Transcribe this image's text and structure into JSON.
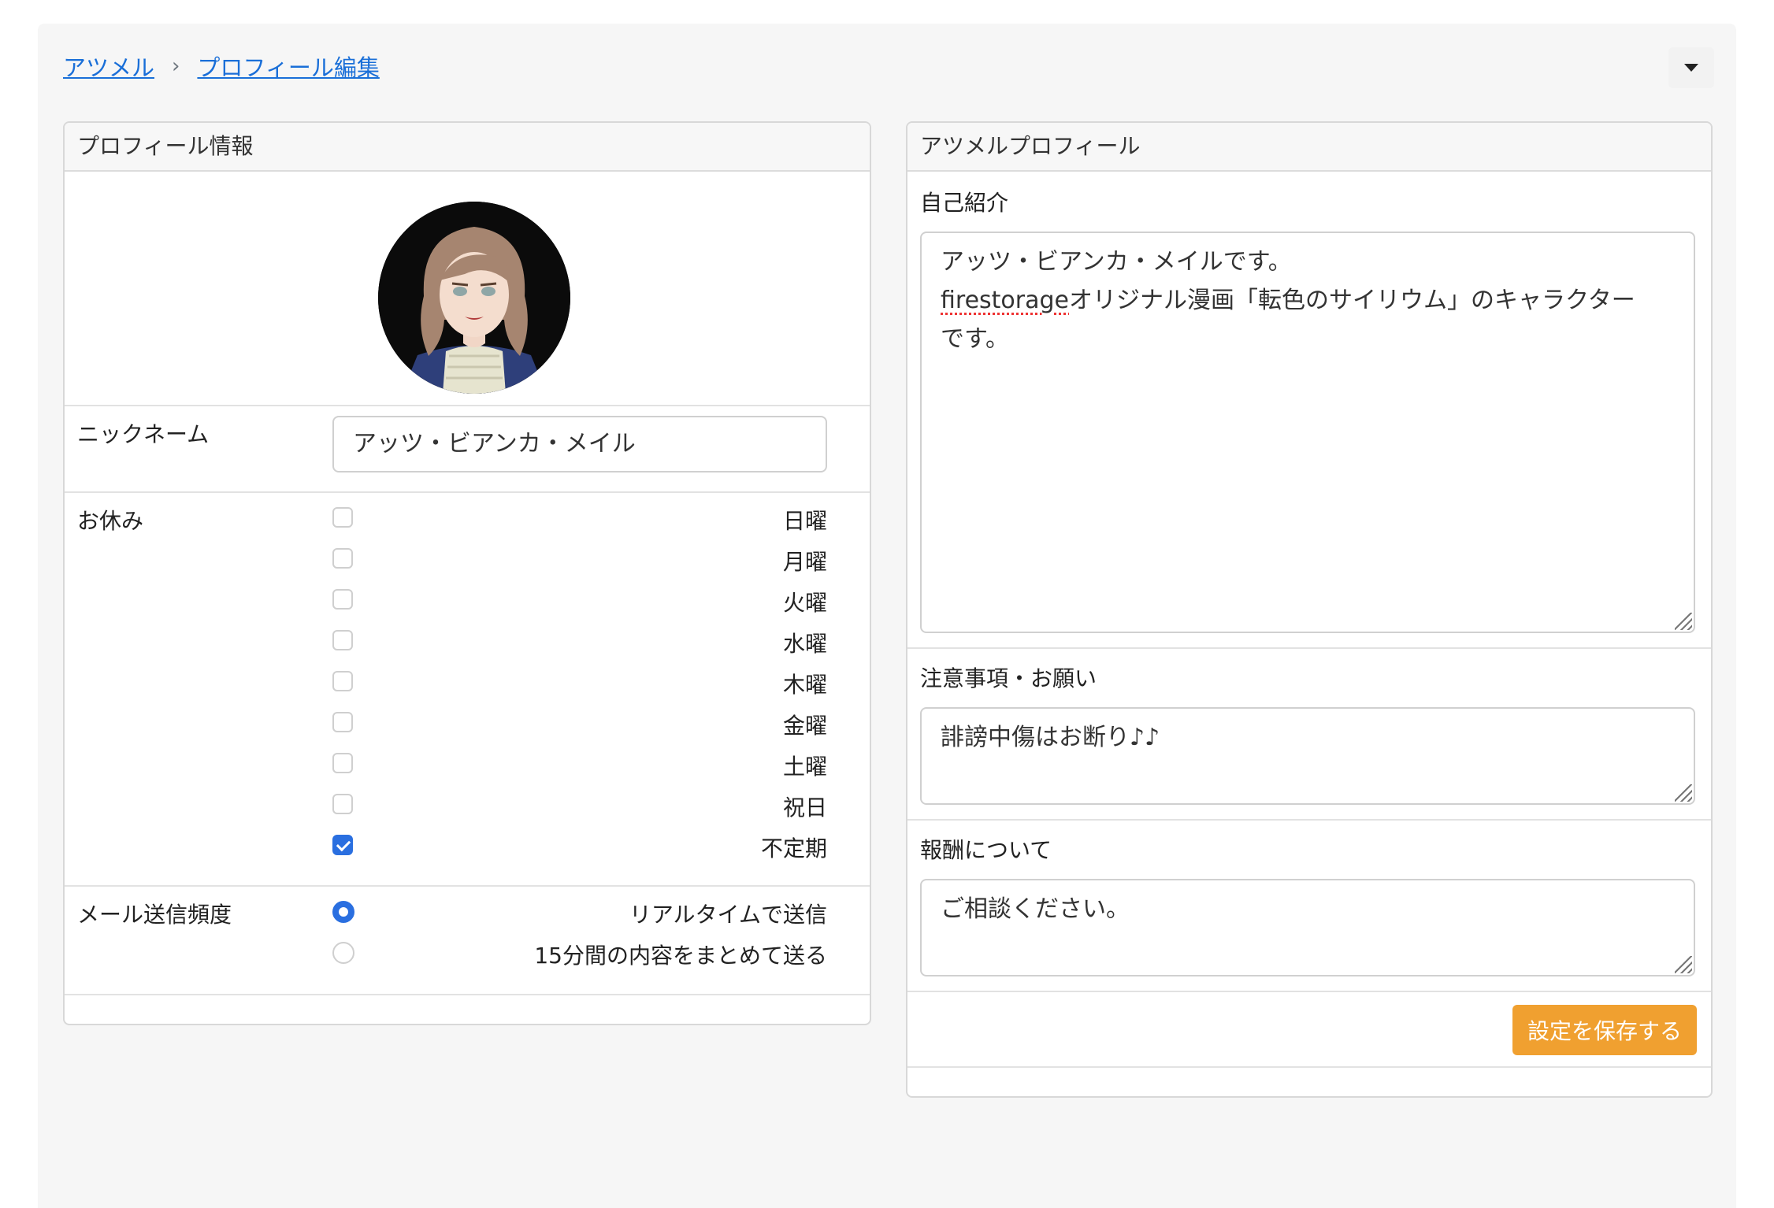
{
  "breadcrumb": {
    "home": "アツメル",
    "current": "プロフィール編集"
  },
  "profile_card": {
    "title": "プロフィール情報",
    "nickname_label": "ニックネーム",
    "nickname_value": "アッツ・ビアンカ・メイル",
    "holidays_label": "お休み",
    "holidays": [
      {
        "label": "日曜",
        "checked": false
      },
      {
        "label": "月曜",
        "checked": false
      },
      {
        "label": "火曜",
        "checked": false
      },
      {
        "label": "水曜",
        "checked": false
      },
      {
        "label": "木曜",
        "checked": false
      },
      {
        "label": "金曜",
        "checked": false
      },
      {
        "label": "土曜",
        "checked": false
      },
      {
        "label": "祝日",
        "checked": false
      },
      {
        "label": "不定期",
        "checked": true
      }
    ],
    "mail_label": "メール送信頻度",
    "mail_options": [
      {
        "label": "リアルタイムで送信",
        "selected": true
      },
      {
        "label": "15分間の内容をまとめて送る",
        "selected": false
      }
    ]
  },
  "atsumeru_card": {
    "title": "アツメルプロフィール",
    "intro_label": "自己紹介",
    "intro_line1": "アッツ・ビアンカ・メイルです。",
    "intro_word": "firestorage",
    "intro_line2_rest": "オリジナル漫画「転色のサイリウム」のキャラクター",
    "intro_line3": "です。",
    "notes_label": "注意事項・お願い",
    "notes_value": "誹謗中傷はお断り♪♪",
    "reward_label": "報酬について",
    "reward_value": "ご相談ください。",
    "save_label": "設定を保存する"
  },
  "colors": {
    "link": "#1a6fd8",
    "accent": "#2a6fe0",
    "save_button": "#f0a030"
  }
}
